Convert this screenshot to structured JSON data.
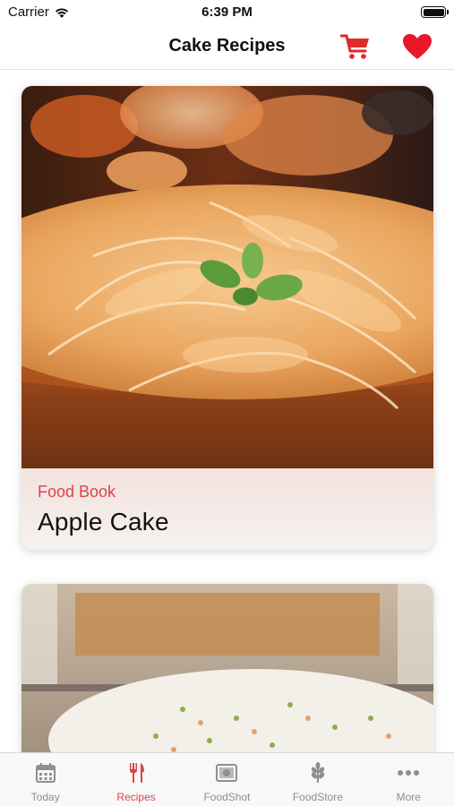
{
  "status_bar": {
    "carrier": "Carrier",
    "time": "6:39 PM"
  },
  "nav": {
    "title": "Cake Recipes",
    "cart_icon": "shopping-cart-icon",
    "favorites_icon": "heart-icon"
  },
  "feed": {
    "cards": [
      {
        "source": "Food Book",
        "title": "Apple Cake"
      },
      {
        "source": "",
        "title": ""
      }
    ]
  },
  "tab_bar": {
    "items": [
      {
        "label": "Today",
        "icon": "calendar-icon",
        "active": false
      },
      {
        "label": "Recipes",
        "icon": "fork-knife-icon",
        "active": true
      },
      {
        "label": "FoodShot",
        "icon": "photo-frame-icon",
        "active": false
      },
      {
        "label": "FoodStore",
        "icon": "leaf-icon",
        "active": false
      },
      {
        "label": "More",
        "icon": "more-dots-icon",
        "active": false
      }
    ]
  },
  "colors": {
    "accent": "#e0414b",
    "inactive": "#8e8e93",
    "cart": "#e02a2a",
    "heart": "#e8182a"
  }
}
